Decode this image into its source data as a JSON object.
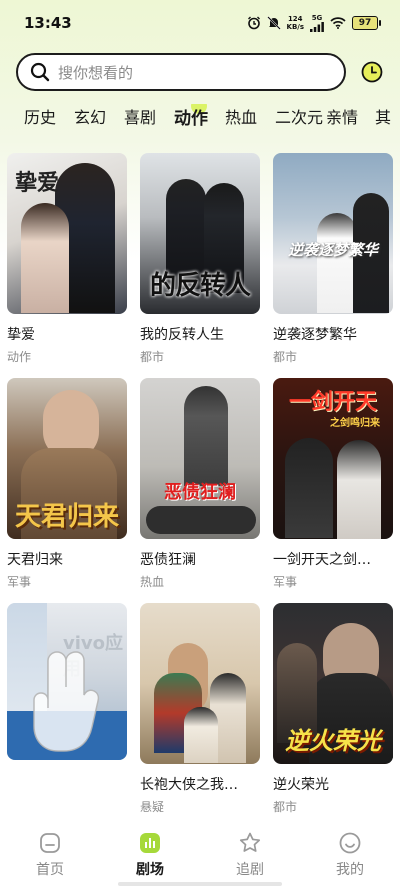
{
  "status": {
    "time": "13:43",
    "net_speed_top": "124",
    "net_speed_bottom": "KB/s",
    "signal_label": "5G",
    "battery": "97"
  },
  "search": {
    "placeholder": "搜你想看的"
  },
  "tabs": [
    "历史",
    "玄幻",
    "喜剧",
    "动作",
    "热血",
    "二次元",
    "亲情",
    "其"
  ],
  "active_tab": "动作",
  "dramas": [
    {
      "title": "挚爱",
      "genre": "动作",
      "poster_text": "挚爱"
    },
    {
      "title": "我的反转人生",
      "genre": "都市",
      "poster_text": "的反转人"
    },
    {
      "title": "逆袭逐梦繁华",
      "genre": "都市",
      "poster_text": "逆袭逐梦繁华"
    },
    {
      "title": "天君归来",
      "genre": "军事",
      "poster_text": "天君归来"
    },
    {
      "title": "恶债狂澜",
      "genre": "热血",
      "poster_text": "恶债狂澜"
    },
    {
      "title": "一剑开天之剑…",
      "genre": "军事",
      "poster_text": "一剑开天",
      "poster_sub": "之剑鸣归来"
    },
    {
      "title": "",
      "genre": "",
      "poster_text": "vivo应用"
    },
    {
      "title": "长袍大侠之我…",
      "genre": "悬疑",
      "poster_text": ""
    },
    {
      "title": "逆火荣光",
      "genre": "都市",
      "poster_text": "逆火荣光"
    }
  ],
  "nav": {
    "home": "首页",
    "theater": "剧场",
    "following": "追剧",
    "mine": "我的"
  },
  "colors": {
    "accent": "#a6d93a",
    "active_tab_dot": "#d8f25a"
  }
}
